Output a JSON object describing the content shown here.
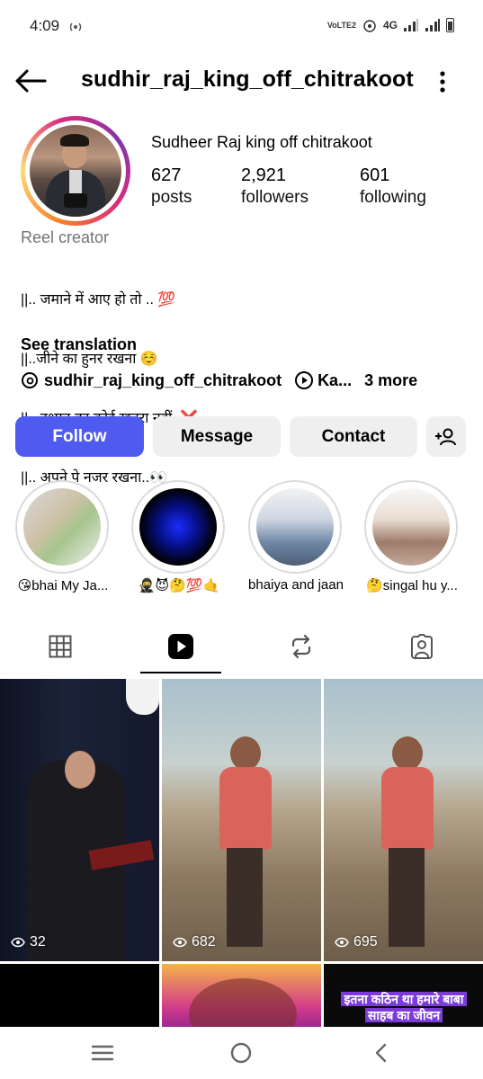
{
  "status_bar": {
    "time": "4:09",
    "network": "4G",
    "volte": "VoLTE2"
  },
  "header": {
    "username": "sudhir_raj_king_off_chitrakoot"
  },
  "profile": {
    "full_name": "Sudheer Raj king off chitrakoot",
    "stats": [
      {
        "value": "627",
        "label": "posts"
      },
      {
        "value": "2,921",
        "label": "followers"
      },
      {
        "value": "601",
        "label": "following"
      }
    ],
    "category": "Reel creator",
    "bio_lines": [
      "||.. जमाने में आए हो तो .. 💯",
      "||..जीने का हुनर रखना ☺️",
      "||.. दुश्मन का कोई खतरा नहीं..❌",
      "||.. अपने पे नजर रखना..👀"
    ],
    "see_translation": "See translation",
    "threads_link": "sudhir_raj_king_off_chitrakoot",
    "reel_link": "Ka...",
    "more_links": "3 more"
  },
  "actions": {
    "follow": "Follow",
    "message": "Message",
    "contact": "Contact"
  },
  "highlights": [
    {
      "label": "😘bhai My Ja..."
    },
    {
      "label": "🥷😈🤔💯🤙"
    },
    {
      "label": "bhaiya and jaan"
    },
    {
      "label": "🤔singal hu y..."
    }
  ],
  "grid": [
    {
      "views": "32"
    },
    {
      "views": "682"
    },
    {
      "views": "695"
    },
    {
      "views": ""
    },
    {
      "views": ""
    },
    {
      "views": "",
      "overlay_text_1": "इतना कठिन था हमारे बाबा",
      "overlay_text_2": "साहब का जीवन"
    }
  ],
  "colors": {
    "follow_button": "#4f5af0",
    "secondary_button": "#efefef",
    "category_text": "#737373"
  }
}
